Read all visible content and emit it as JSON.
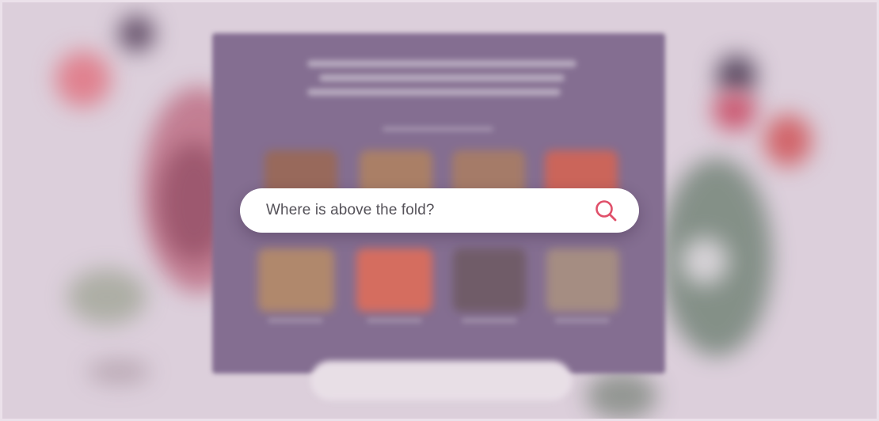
{
  "search": {
    "query": "Where is above the fold?",
    "icon": "search-icon",
    "icon_color": "#e0506a"
  },
  "theme": {
    "card_color": "#725b82",
    "background_color": "#ddd1dc"
  }
}
